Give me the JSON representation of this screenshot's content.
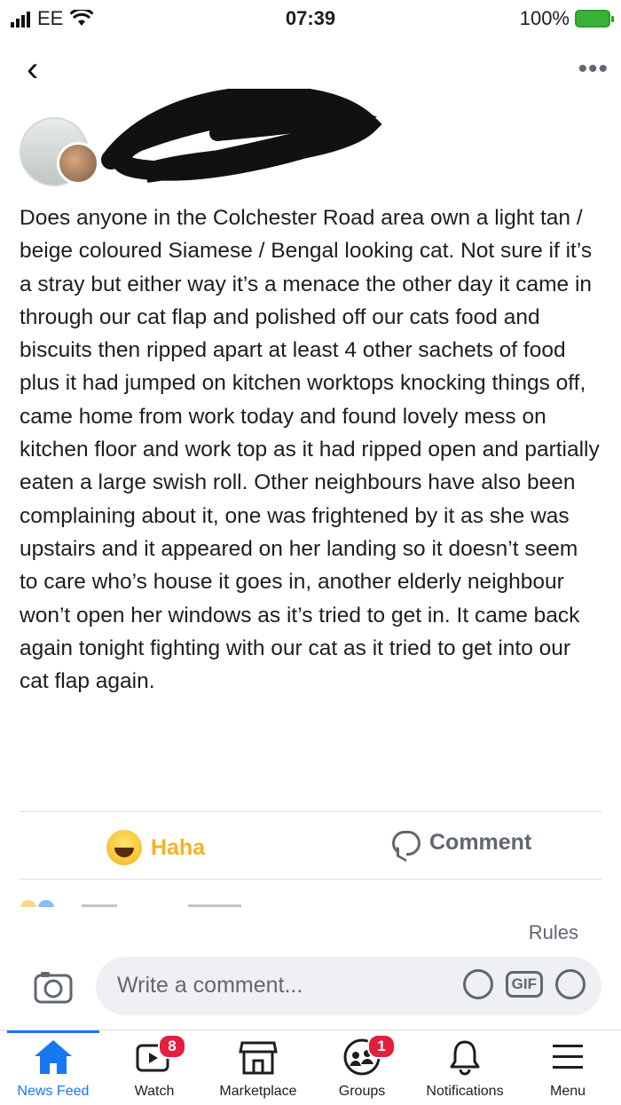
{
  "status_bar": {
    "carrier": "EE",
    "time": "07:39",
    "battery": "100%"
  },
  "post": {
    "body": "Does anyone in the Colchester Road area own a light tan / beige coloured Siamese / Bengal looking cat. Not sure if it’s a stray but either way it’s a menace the other day it came in through our cat flap and polished off our cats food and biscuits then ripped apart at least 4 other sachets of food plus it had jumped on kitchen worktops knocking things off, came home from work today and found lovely mess on kitchen floor and work top as it had ripped open and partially eaten a large swish roll. Other neighbours have also been complaining about it, one was frightened by it as she was upstairs and it appeared on her landing so it doesn’t seem to care who’s house it goes in, another elderly neighbour won’t open her windows as it’s tried to get in. It came back again tonight fighting with our cat as it tried to get into our cat flap again."
  },
  "actions": {
    "haha_label": "Haha",
    "comment_label": "Comment"
  },
  "rules_label": "Rules",
  "comment_box": {
    "placeholder": "Write a comment...",
    "gif_label": "GIF"
  },
  "tabs": [
    {
      "label": "News Feed",
      "icon": "home-icon",
      "active": true
    },
    {
      "label": "Watch",
      "icon": "watch-icon",
      "badge": "8"
    },
    {
      "label": "Marketplace",
      "icon": "marketplace-icon"
    },
    {
      "label": "Groups",
      "icon": "groups-icon",
      "badge": "1"
    },
    {
      "label": "Notifications",
      "icon": "bell-icon"
    },
    {
      "label": "Menu",
      "icon": "menu-icon"
    }
  ],
  "colors": {
    "accent": "#1877f2",
    "haha_text": "#f7b125",
    "badge": "#e41e3f",
    "battery": "#36b336"
  }
}
